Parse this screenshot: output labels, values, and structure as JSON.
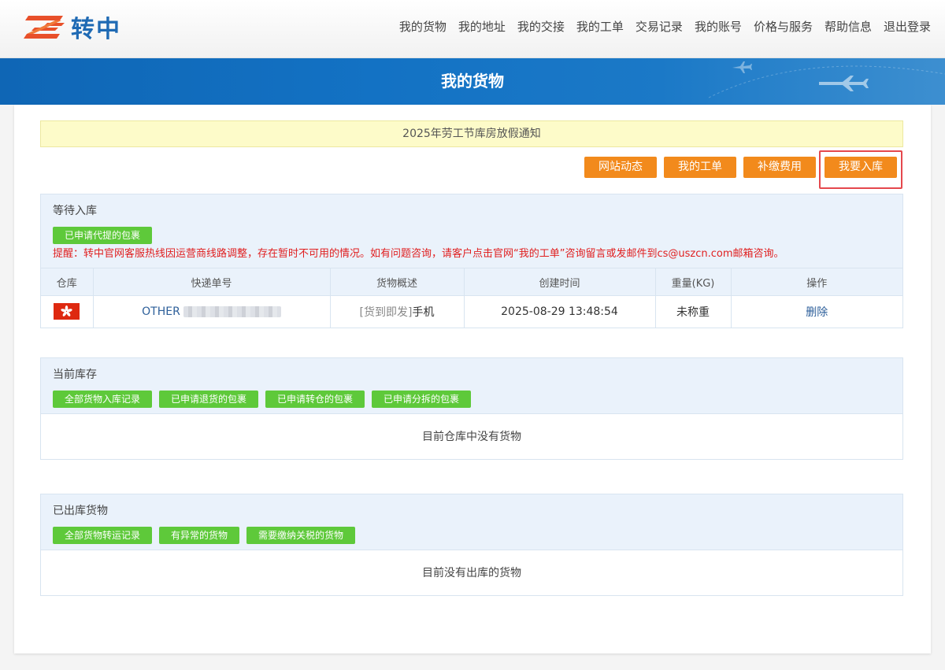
{
  "brand": {
    "name": "转中"
  },
  "nav": [
    "我的货物",
    "我的地址",
    "我的交接",
    "我的工单",
    "交易记录",
    "我的账号",
    "价格与服务",
    "帮助信息",
    "退出登录"
  ],
  "banner": {
    "title": "我的货物"
  },
  "notice": "2025年劳工节库房放假通知",
  "actions": [
    "网站动态",
    "我的工单",
    "补缴费用",
    "我要入库"
  ],
  "pending": {
    "title": "等待入库",
    "tag": "已申请代提的包裹",
    "warning": "提醒：转中官网客服热线因运营商线路调整，存在暂时不可用的情况。如有问题咨询，请客户点击官网“我的工单”咨询留言或发邮件到cs@uszcn.com邮箱咨询。",
    "columns": [
      "仓库",
      "快递单号",
      "货物概述",
      "创建时间",
      "重量(KG)",
      "操作"
    ],
    "rows": [
      {
        "warehouse_flag": "hong-kong-flag-icon",
        "carrier": "OTHER",
        "desc_prefix": "[货到即发]",
        "desc": "手机",
        "created": "2025-08-29 13:48:54",
        "weight": "未称重",
        "action": "删除"
      }
    ]
  },
  "inventory": {
    "title": "当前库存",
    "tags": [
      "全部货物入库记录",
      "已申请退货的包裹",
      "已申请转仓的包裹",
      "已申请分拆的包裹"
    ],
    "empty": "目前仓库中没有货物"
  },
  "shipped": {
    "title": "已出库货物",
    "tags": [
      "全部货物转运记录",
      "有异常的货物",
      "需要缴纳关税的货物"
    ],
    "empty": "目前没有出库的货物"
  },
  "colors": {
    "brand_blue": "#1f6ab4",
    "orange": "#f28a1c",
    "green": "#5ec93a",
    "alert_red": "#e01f1f",
    "highlight_border": "#e5484d"
  }
}
